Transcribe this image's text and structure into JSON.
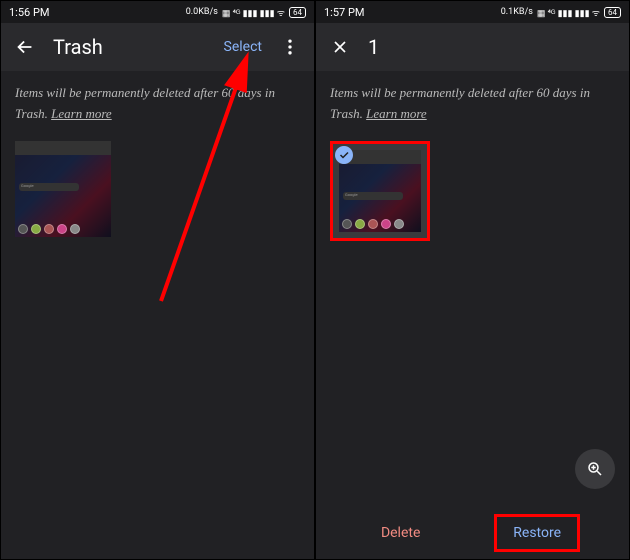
{
  "left": {
    "status": {
      "time": "1:56 PM",
      "data_rate": "0.0KB/s",
      "battery": "64"
    },
    "appbar": {
      "title": "Trash",
      "select_label": "Select"
    },
    "info_prefix": "Items will be permanently deleted after 60 days in Trash. ",
    "learn_more": "Learn more"
  },
  "right": {
    "status": {
      "time": "1:57 PM",
      "data_rate": "0.1KB/s",
      "battery": "64"
    },
    "appbar": {
      "selected_count": "1"
    },
    "info_prefix": "Items will be permanently deleted after 60 days in Trash. ",
    "learn_more": "Learn more",
    "actions": {
      "delete_label": "Delete",
      "restore_label": "Restore"
    }
  },
  "thumb_google": "Google"
}
